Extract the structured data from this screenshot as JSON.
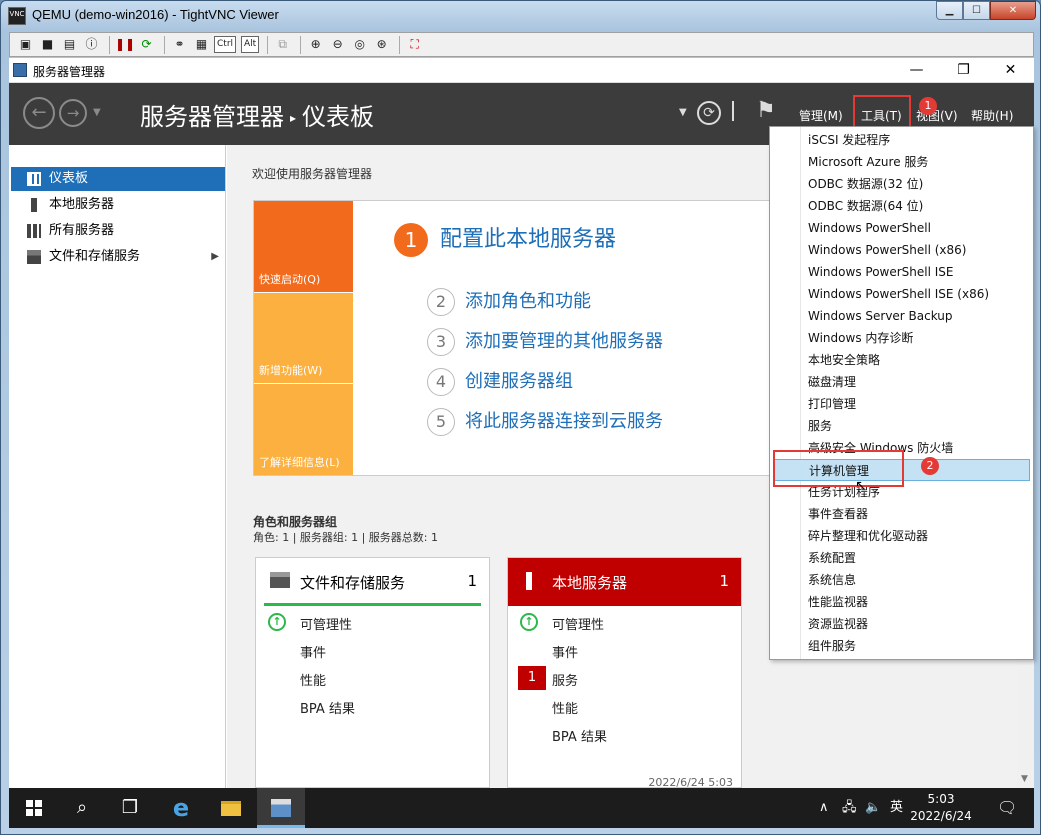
{
  "vnc": {
    "title": "QEMU (demo-win2016) - TightVNC Viewer",
    "icon_text": "VNC",
    "toolbar_ctrl": "Ctrl",
    "toolbar_alt": "Alt"
  },
  "window": {
    "title": "服务器管理器"
  },
  "header": {
    "breadcrumb_app": "服务器管理器",
    "breadcrumb_page": "仪表板",
    "menus": {
      "manage": "管理(M)",
      "tools": "工具(T)",
      "view": "视图(V)",
      "help": "帮助(H)"
    }
  },
  "badges": {
    "one": "1",
    "two": "2"
  },
  "sidebar": {
    "items": [
      {
        "label": "仪表板"
      },
      {
        "label": "本地服务器"
      },
      {
        "label": "所有服务器"
      },
      {
        "label": "文件和存储服务"
      }
    ]
  },
  "main": {
    "welcome": "欢迎使用服务器管理器",
    "tiles": {
      "quick_start": "快速启动(Q)",
      "new_features": "新增功能(W)",
      "learn_more": "了解详细信息(L)"
    },
    "steps": [
      {
        "num": "1",
        "label": "配置此本地服务器"
      },
      {
        "num": "2",
        "label": "添加角色和功能"
      },
      {
        "num": "3",
        "label": "添加要管理的其他服务器"
      },
      {
        "num": "4",
        "label": "创建服务器组"
      },
      {
        "num": "5",
        "label": "将此服务器连接到云服务"
      }
    ],
    "roles_heading": "角色和服务器组",
    "roles_summary": "角色: 1 | 服务器组: 1 | 服务器总数: 1",
    "cards": [
      {
        "title": "文件和存储服务",
        "count": "1",
        "rows": [
          "可管理性",
          "事件",
          "性能",
          "BPA 结果"
        ]
      },
      {
        "title": "本地服务器",
        "count": "1",
        "rows": [
          "可管理性",
          "事件",
          "服务",
          "性能",
          "BPA 结果"
        ],
        "service_badge": "1",
        "timestamp": "2022/6/24 5:03"
      }
    ]
  },
  "tools_menu": {
    "items": [
      "iSCSI 发起程序",
      "Microsoft Azure 服务",
      "ODBC 数据源(32 位)",
      "ODBC 数据源(64 位)",
      "Windows PowerShell",
      "Windows PowerShell (x86)",
      "Windows PowerShell ISE",
      "Windows PowerShell ISE (x86)",
      "Windows Server Backup",
      "Windows 内存诊断",
      "本地安全策略",
      "磁盘清理",
      "打印管理",
      "服务",
      "高级安全 Windows 防火墙",
      "计算机管理",
      "任务计划程序",
      "事件查看器",
      "碎片整理和优化驱动器",
      "系统配置",
      "系统信息",
      "性能监视器",
      "资源监视器",
      "组件服务"
    ],
    "highlighted_index": 15
  },
  "taskbar": {
    "time": "5:03",
    "date": "2022/6/24",
    "ime": "英"
  },
  "colors": {
    "accent_blue": "#1e6fb8",
    "orange": "#f26a1b",
    "amber": "#fbb040",
    "header_dark": "#3c3c3c",
    "alert_red": "#c00000",
    "annotation_red": "#e43a36",
    "ok_green": "#2db84b"
  }
}
